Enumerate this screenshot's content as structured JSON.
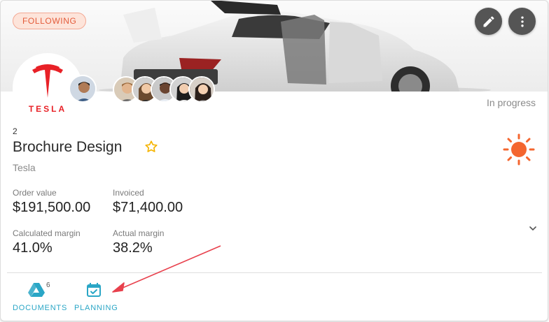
{
  "badge": {
    "label": "FOLLOWING"
  },
  "header": {
    "edit_icon": "pencil-icon",
    "more_icon": "more-vert-icon"
  },
  "logo": {
    "text": "TESLA",
    "color": "#e82127"
  },
  "status": "In progress",
  "project": {
    "number": "2",
    "title": "Brochure Design",
    "client": "Tesla"
  },
  "metrics": {
    "order_value": {
      "label": "Order value",
      "value": "$191,500.00"
    },
    "invoiced": {
      "label": "Invoiced",
      "value": "$71,400.00"
    },
    "calculated_margin": {
      "label": "Calculated margin",
      "value": "41.0%"
    },
    "actual_margin": {
      "label": "Actual margin",
      "value": "38.2%"
    }
  },
  "actions": {
    "documents": {
      "label": "DOCUMENTS",
      "count": "6"
    },
    "planning": {
      "label": "PLANNING"
    }
  },
  "colors": {
    "accent": "#2aa6c6",
    "sun": "#f4662f",
    "star": "#f5b400",
    "badge_text": "#e35c3b",
    "arrow": "#e8414d"
  }
}
